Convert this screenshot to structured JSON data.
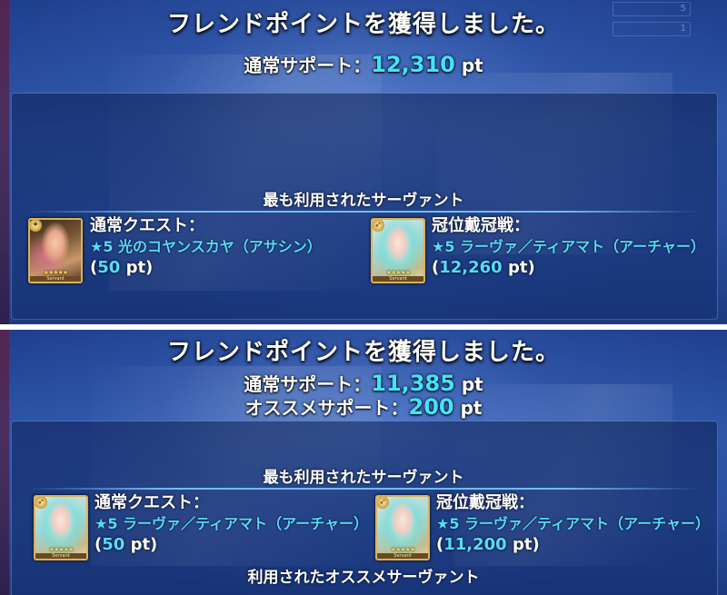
{
  "panels": [
    {
      "title": "フレンドポイントを獲得しました。",
      "support_lines": [
        {
          "label": "通常サポート：",
          "value": "12,310",
          "unit": " pt"
        }
      ],
      "hud": {
        "top_value": "5",
        "bottom_value": "1"
      },
      "section_header": "最も利用されたサーヴァント",
      "entries": [
        {
          "label": "通常クエスト：",
          "servant": "★5 光のコヤンスカヤ（アサシン）",
          "points_open": "(",
          "points": "50",
          "points_unit": " pt)",
          "card_art": "assassin"
        },
        {
          "label": "冠位戴冠戦：",
          "servant": "★5 ラーヴァ／ティアマト（アーチャー）",
          "points_open": "(",
          "points": "12,260",
          "points_unit": " pt)",
          "card_art": "archer"
        }
      ]
    },
    {
      "title": "フレンドポイントを獲得しました。",
      "support_lines": [
        {
          "label": "通常サポート：",
          "value": "11,385",
          "unit": " pt"
        },
        {
          "label": "オススメサポート：",
          "value": "200",
          "unit": " pt"
        }
      ],
      "section_header": "最も利用されたサーヴァント",
      "entries": [
        {
          "label": "通常クエスト：",
          "servant": "★5 ラーヴァ／ティアマト（アーチャー）",
          "points_open": "(",
          "points": "50",
          "points_unit": " pt)",
          "card_art": "archer"
        },
        {
          "label": "冠位戴冠戦：",
          "servant": "★5 ラーヴァ／ティアマト（アーチャー）",
          "points_open": "(",
          "points": "11,200",
          "points_unit": " pt)",
          "card_art": "archer"
        }
      ],
      "section_header_2": "利用されたオススメサーヴァント"
    }
  ],
  "card": {
    "stars": "★★★★★",
    "label": "Servant",
    "class_icon_assassin": "assassin-class-icon",
    "class_icon_archer": "archer-class-icon"
  },
  "colors": {
    "accent_cyan": "#42e3ff",
    "servant_name": "#55dcff",
    "card_border": "#d9b25c"
  }
}
